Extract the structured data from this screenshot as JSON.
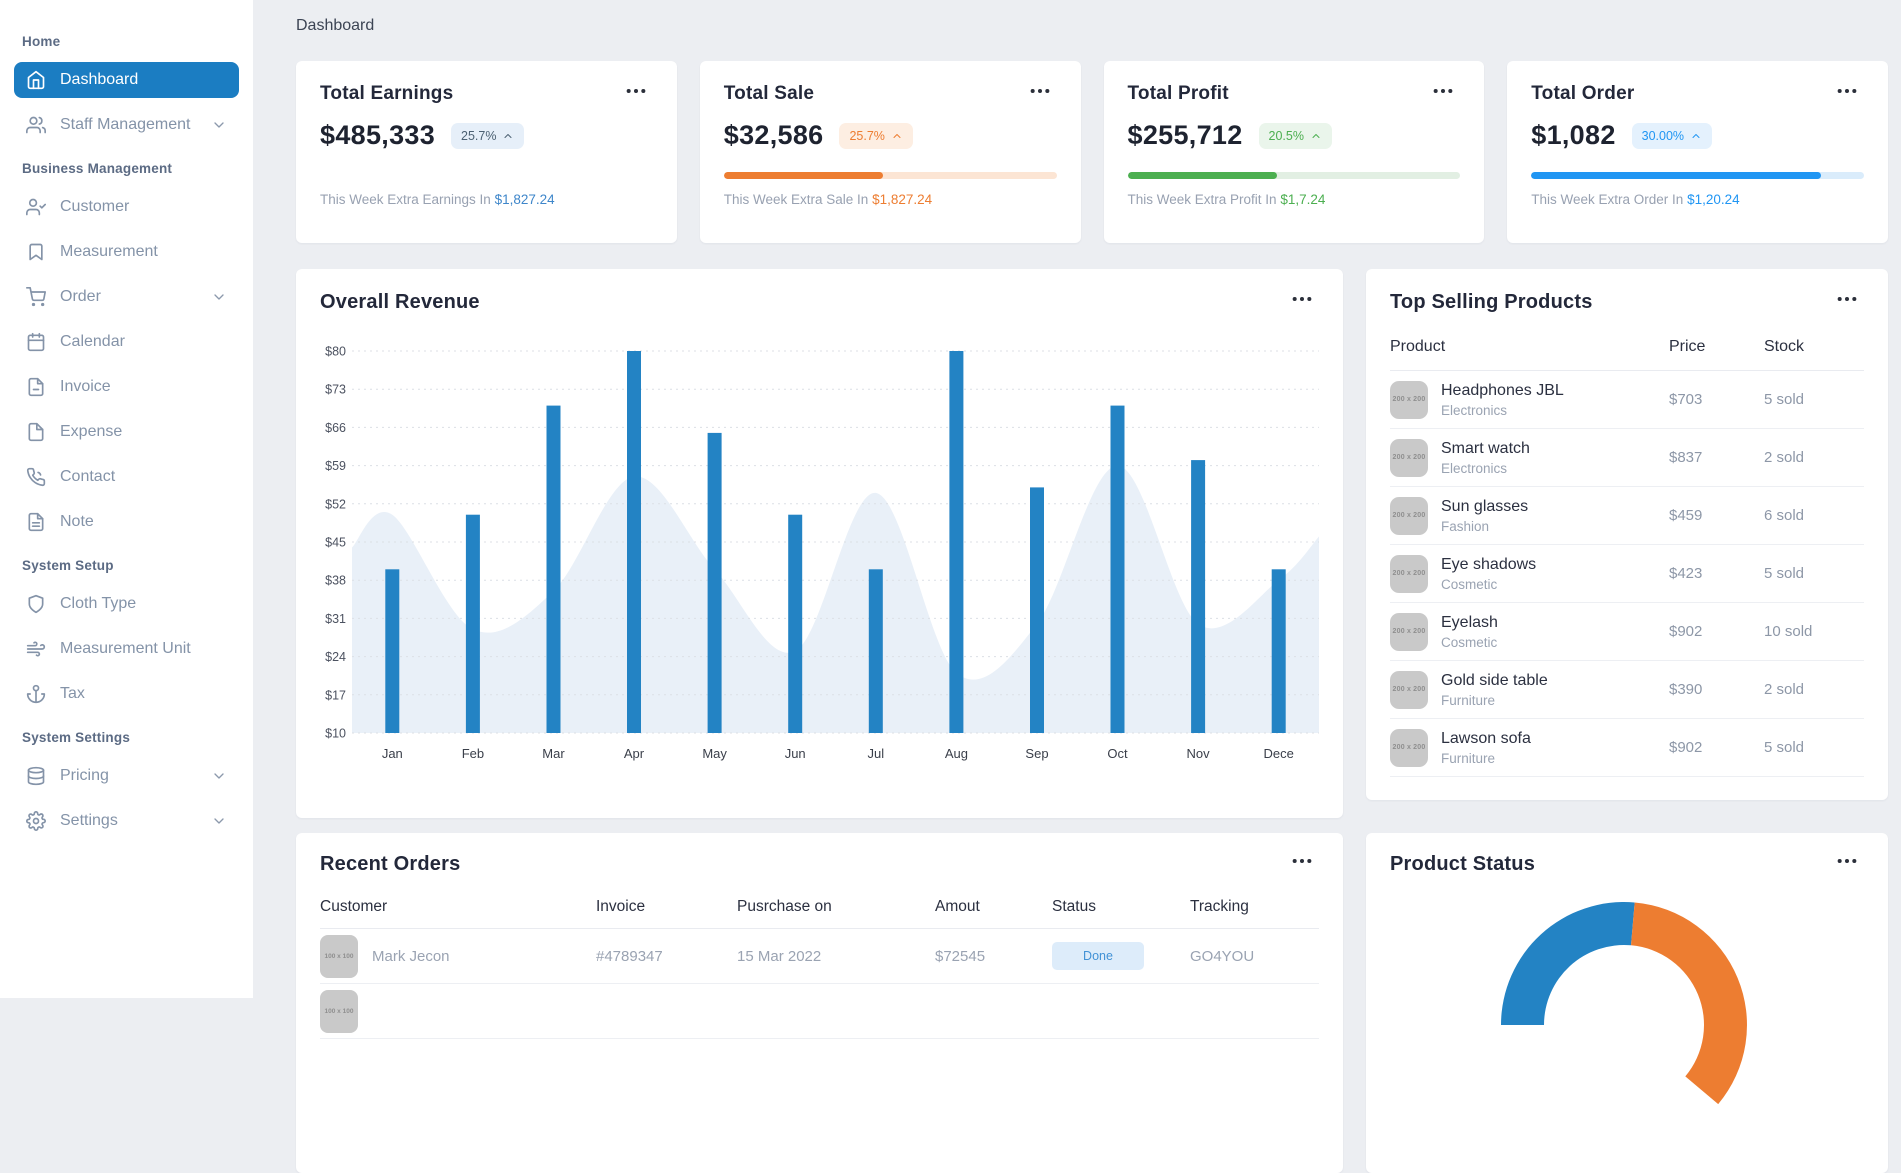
{
  "page": {
    "title": "Dashboard"
  },
  "colors": {
    "primary_blue": "#1b7dc2",
    "bar_blue": "#2383c4",
    "orange": "#ed7d31",
    "green": "#4caf50",
    "order_blue": "#2196f3",
    "area_fill": "#e9f0f8"
  },
  "sidebar": {
    "sections": [
      {
        "label": "Home",
        "items": [
          {
            "label": "Dashboard",
            "icon": "home",
            "active": true
          },
          {
            "label": "Staff Management",
            "icon": "users",
            "chevron": true
          }
        ]
      },
      {
        "label": "Business Management",
        "items": [
          {
            "label": "Customer",
            "icon": "user-check"
          },
          {
            "label": "Measurement",
            "icon": "bookmark"
          },
          {
            "label": "Order",
            "icon": "cart",
            "chevron": true
          },
          {
            "label": "Calendar",
            "icon": "calendar"
          },
          {
            "label": "Invoice",
            "icon": "file-minus"
          },
          {
            "label": "Expense",
            "icon": "file"
          },
          {
            "label": "Contact",
            "icon": "phone"
          },
          {
            "label": "Note",
            "icon": "file-text"
          }
        ]
      },
      {
        "label": "System Setup",
        "items": [
          {
            "label": "Cloth Type",
            "icon": "shield"
          },
          {
            "label": "Measurement Unit",
            "icon": "wind"
          },
          {
            "label": "Tax",
            "icon": "anchor"
          }
        ]
      },
      {
        "label": "System Settings",
        "items": [
          {
            "label": "Pricing",
            "icon": "database",
            "chevron": true
          },
          {
            "label": "Settings",
            "icon": "gear",
            "chevron": true
          }
        ]
      }
    ]
  },
  "stat_cards": [
    {
      "title": "Total Earnings",
      "value": "$485,333",
      "badge": "25.7%",
      "badge_bg": "#e6eff9",
      "badge_color": "#4c6173",
      "progress": null,
      "bar_color": "#2e86de",
      "track_color": "#e6eff9",
      "desc_prefix": "This Week Extra Earnings In ",
      "desc_amount": "$1,827.24",
      "amount_color": "#3e86ca"
    },
    {
      "title": "Total Sale",
      "value": "$32,586",
      "badge": "25.7%",
      "badge_bg": "#fdeee2",
      "badge_color": "#ed7d31",
      "progress": 48,
      "bar_color": "#ed7d31",
      "track_color": "#fce5d4",
      "desc_prefix": "This Week Extra Sale In ",
      "desc_amount": "$1,827.24",
      "amount_color": "#ed7d31"
    },
    {
      "title": "Total Profit",
      "value": "$255,712",
      "badge": "20.5%",
      "badge_bg": "#eaf5eb",
      "badge_color": "#4caf50",
      "progress": 45,
      "bar_color": "#4caf50",
      "track_color": "#e2efe3",
      "desc_prefix": "This Week Extra Profit In ",
      "desc_amount": "$1,7.24",
      "amount_color": "#4caf50"
    },
    {
      "title": "Total Order",
      "value": "$1,082",
      "badge": "30.00%",
      "badge_bg": "#e4f1fd",
      "badge_color": "#2196f3",
      "progress": 87,
      "bar_color": "#2196f3",
      "track_color": "#daecfb",
      "desc_prefix": "This Week Extra Order In ",
      "desc_amount": "$1,20.24",
      "amount_color": "#2196f3"
    }
  ],
  "chart_data": [
    {
      "type": "bar",
      "title": "Overall Revenue",
      "categories": [
        "Jan",
        "Feb",
        "Mar",
        "Apr",
        "May",
        "Jun",
        "Jul",
        "Aug",
        "Sep",
        "Oct",
        "Nov",
        "Dece"
      ],
      "values": [
        40,
        50,
        70,
        80,
        65,
        50,
        40,
        80,
        55,
        70,
        60,
        40
      ],
      "y_ticks": [
        80,
        73,
        66,
        59,
        52,
        45,
        38,
        31,
        24,
        17,
        10
      ],
      "y_tick_prefix": "$",
      "ylim": [
        10,
        80
      ],
      "grid": "dotted-horizontal",
      "legend": "none",
      "bar_color": "#2383c4",
      "area_series": {
        "name": "background-area",
        "color": "#e9f0f8",
        "x": [
          0,
          0.5,
          1.5,
          2.5,
          3.5,
          4.5,
          5.5,
          6.5,
          7.5,
          8.5,
          9.5,
          10.5,
          11.5,
          12
        ],
        "values": [
          44,
          50,
          29,
          36,
          57,
          40,
          25,
          54,
          21,
          30,
          59,
          30,
          38,
          46
        ]
      }
    },
    {
      "type": "donut",
      "title": "Product Status",
      "start_angle_deg": 180,
      "direction": "clockwise",
      "segments": [
        {
          "name": "segment-blue",
          "color": "#2383c4",
          "sweep_deg": 95
        },
        {
          "name": "segment-orange",
          "color": "#ed7d31",
          "sweep_deg": 125
        }
      ],
      "note": "bottom of donut cut off by viewport"
    }
  ],
  "top_products": {
    "title": "Top Selling Products",
    "headers": [
      "Product",
      "Price",
      "Stock"
    ],
    "thumb_label": "200 x 200",
    "rows": [
      {
        "name": "Headphones JBL",
        "category": "Electronics",
        "price": "$703",
        "stock": "5 sold"
      },
      {
        "name": "Smart watch",
        "category": "Electronics",
        "price": "$837",
        "stock": "2 sold"
      },
      {
        "name": "Sun glasses",
        "category": "Fashion",
        "price": "$459",
        "stock": "6 sold"
      },
      {
        "name": "Eye shadows",
        "category": "Cosmetic",
        "price": "$423",
        "stock": "5 sold"
      },
      {
        "name": "Eyelash",
        "category": "Cosmetic",
        "price": "$902",
        "stock": "10 sold"
      },
      {
        "name": "Gold side table",
        "category": "Furniture",
        "price": "$390",
        "stock": "2 sold"
      },
      {
        "name": "Lawson sofa",
        "category": "Furniture",
        "price": "$902",
        "stock": "5 sold"
      }
    ]
  },
  "recent_orders": {
    "title": "Recent Orders",
    "headers": [
      "Customer",
      "Invoice",
      "Pusrchase on",
      "Amout",
      "Status",
      "Tracking"
    ],
    "avatar_label": "100 x 100",
    "rows": [
      {
        "customer": "Mark Jecon",
        "invoice": "#4789347",
        "purchase_on": "15 Mar 2022",
        "amount": "$72545",
        "status": "Done",
        "tracking": "GO4YOU",
        "partial": false
      },
      {
        "customer": "",
        "invoice": "",
        "purchase_on": "",
        "amount": "",
        "status": "",
        "tracking": "",
        "partial": true
      }
    ]
  },
  "product_status": {
    "title": "Product Status"
  }
}
